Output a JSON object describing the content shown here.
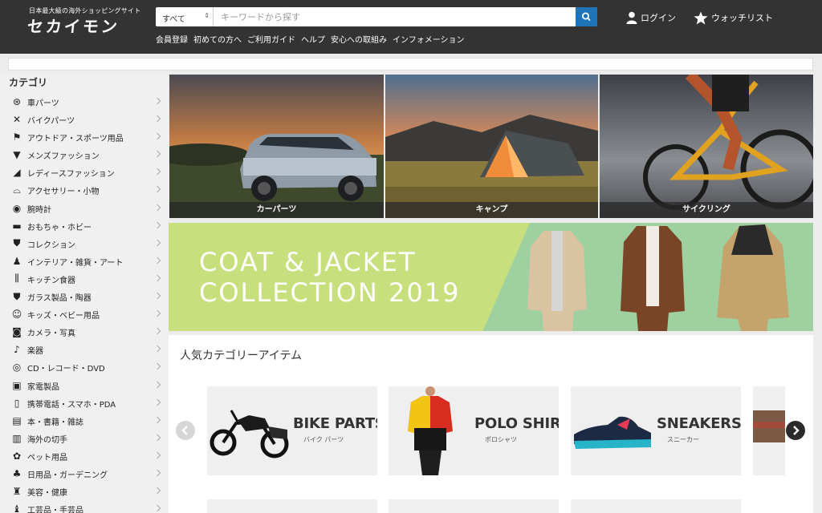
{
  "header": {
    "tagline": "日本最大級の海外ショッピングサイト",
    "logo": "セカイモン",
    "search": {
      "category": "すべて",
      "placeholder": "キーワードから探す"
    },
    "login": "ログイン",
    "watchlist": "ウォッチリスト",
    "nav": [
      "会員登録",
      "初めての方へ",
      "ご利用ガイド",
      "ヘルプ",
      "安心への取組み",
      "インフォメーション"
    ]
  },
  "sidebar": {
    "title": "カテゴリ",
    "items": [
      {
        "label": "車パーツ",
        "icon": "wheel-icon"
      },
      {
        "label": "バイクパーツ",
        "icon": "tools-icon"
      },
      {
        "label": "アウトドア・スポーツ用品",
        "icon": "runner-icon"
      },
      {
        "label": "メンズファッション",
        "icon": "shirt-icon"
      },
      {
        "label": "レディースファッション",
        "icon": "heel-icon"
      },
      {
        "label": "アクセサリー・小物",
        "icon": "hat-icon"
      },
      {
        "label": "腕時計",
        "icon": "watch-icon"
      },
      {
        "label": "おもちゃ・ホビー",
        "icon": "toy-car-icon"
      },
      {
        "label": "コレクション",
        "icon": "shield-icon"
      },
      {
        "label": "インテリア・雑貨・アート",
        "icon": "lamp-icon"
      },
      {
        "label": "キッチン食器",
        "icon": "cutlery-icon"
      },
      {
        "label": "ガラス製品・陶器",
        "icon": "vase-icon"
      },
      {
        "label": "キッズ・ベビー用品",
        "icon": "baby-icon"
      },
      {
        "label": "カメラ・写真",
        "icon": "camera-icon"
      },
      {
        "label": "楽器",
        "icon": "guitar-icon"
      },
      {
        "label": "CD・レコード・DVD",
        "icon": "disc-icon"
      },
      {
        "label": "家電製品",
        "icon": "appliance-icon"
      },
      {
        "label": "携帯電話・スマホ・PDA",
        "icon": "phone-icon"
      },
      {
        "label": "本・書籍・雑誌",
        "icon": "book-icon"
      },
      {
        "label": "海外の切手",
        "icon": "stamp-icon"
      },
      {
        "label": "ペット用品",
        "icon": "paw-icon"
      },
      {
        "label": "日用品・ガーデニング",
        "icon": "plant-icon"
      },
      {
        "label": "美容・健康",
        "icon": "beauty-icon"
      },
      {
        "label": "工芸品・手芸品",
        "icon": "craft-icon"
      }
    ]
  },
  "hero": {
    "tiles": [
      {
        "caption": "カーパーツ"
      },
      {
        "caption": "キャンプ"
      },
      {
        "caption": "サイクリング"
      }
    ]
  },
  "promo": {
    "line1": "COAT & JACKET",
    "line2": "COLLECTION 2019"
  },
  "popular": {
    "title": "人気カテゴリーアイテム",
    "cards": [
      {
        "title": "BIKE PARTS",
        "subtitle": "バイク パーツ"
      },
      {
        "title": "POLO SHIRTS",
        "subtitle": "ポロシャツ"
      },
      {
        "title": "SNEAKERS",
        "subtitle": "スニーカー"
      }
    ]
  },
  "colors": {
    "header_bg": "#333333",
    "search_button": "#1f73b7",
    "promo_green": "#c7df7d",
    "promo_mint": "#9fd0a0"
  }
}
